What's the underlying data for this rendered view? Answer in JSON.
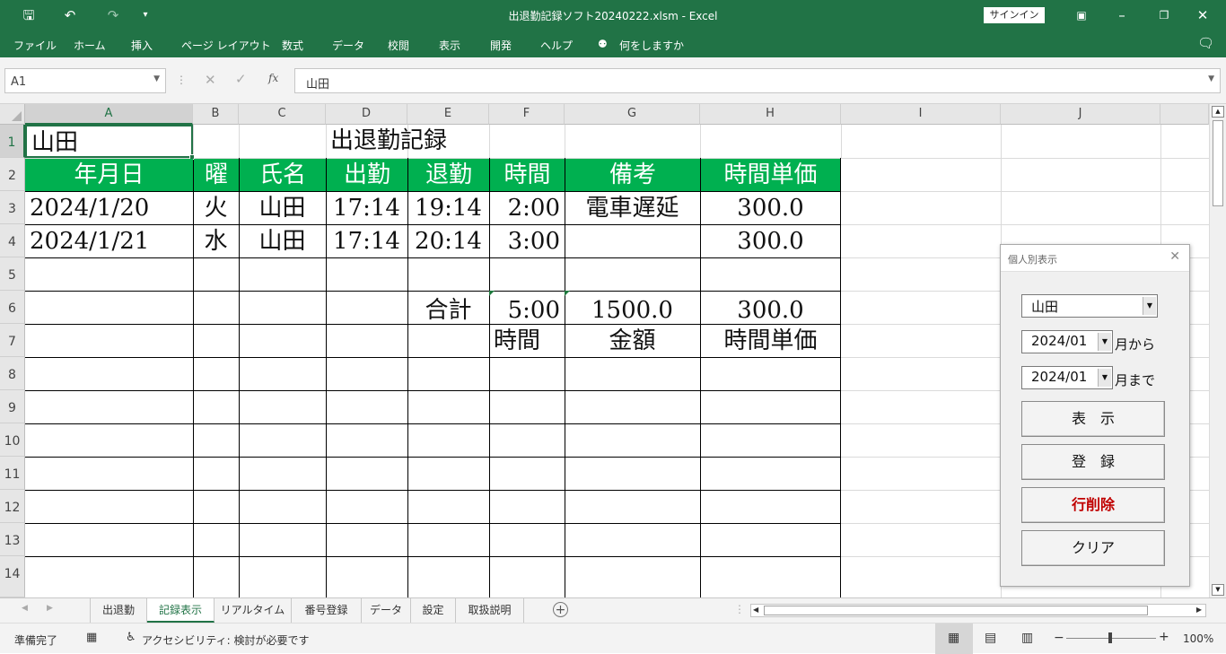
{
  "window": {
    "title": "出退勤記録ソフト20240222.xlsm  -  Excel",
    "signin_label": "サインイン"
  },
  "ribbon": {
    "tabs": [
      "ファイル",
      "ホーム",
      "挿入",
      "ページ レイアウト",
      "数式",
      "データ",
      "校閲",
      "表示",
      "開発",
      "ヘルプ",
      "何をしますか"
    ]
  },
  "formula_bar": {
    "name_box": "A1",
    "fx_label": "fx",
    "value": "山田"
  },
  "columns": [
    "A",
    "B",
    "C",
    "D",
    "E",
    "F",
    "G",
    "H",
    "I",
    "J"
  ],
  "rows": [
    "1",
    "2",
    "3",
    "4",
    "5",
    "6",
    "7",
    "8",
    "9",
    "10",
    "11",
    "12",
    "13",
    "14"
  ],
  "sheet": {
    "a1": "山田",
    "title": "出退勤記録",
    "headers": [
      "年月日",
      "曜",
      "氏名",
      "出勤",
      "退勤",
      "時間",
      "備考",
      "時間単価"
    ],
    "records": [
      [
        "2024/1/20",
        "火",
        "山田",
        "17:14",
        "19:14",
        "2:00",
        "電車遅延",
        "300.0"
      ],
      [
        "2024/1/21",
        "水",
        "山田",
        "17:14",
        "20:14",
        "3:00",
        "",
        "300.0"
      ]
    ],
    "total_label": "合計",
    "total_time": "5:00",
    "total_amount": "1500.0",
    "total_rate": "300.0",
    "label_time": "時間",
    "label_amount": "金額",
    "label_rate": "時間単価"
  },
  "sheet_tabs": [
    "出退勤",
    "記録表示",
    "リアルタイム",
    "番号登録",
    "データ",
    "設定",
    "取扱説明"
  ],
  "status": {
    "ready": "準備完了",
    "accessibility": "アクセシビリティ: 検討が必要です",
    "zoom": "100%"
  },
  "dialog": {
    "title": "個人別表示",
    "name_select": "山田",
    "from_month": "2024/01",
    "from_suffix": "月から",
    "to_month": "2024/01",
    "to_suffix": "月まで",
    "btn_show": "表　示",
    "btn_register": "登　録",
    "btn_delete": "行削除",
    "btn_clear": "クリア",
    "delete_color": "#c00000"
  },
  "colors": {
    "excel_green": "#217346",
    "header_green": "#00b050"
  }
}
